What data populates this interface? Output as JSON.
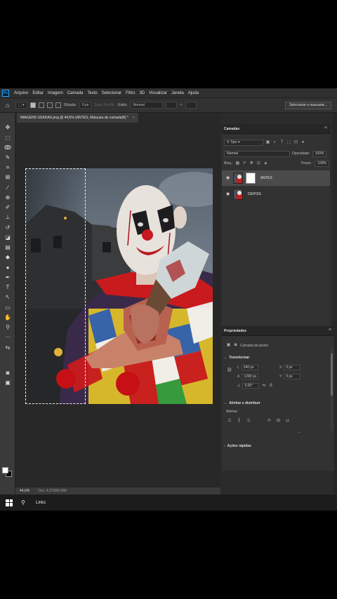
{
  "menu": {
    "logo": "Ps",
    "items": [
      "Arquivo",
      "Editar",
      "Imagem",
      "Camada",
      "Texto",
      "Selecionar",
      "Filtro",
      "3D",
      "Visualizar",
      "Janela",
      "Ajuda"
    ]
  },
  "options_bar": {
    "difusao_label": "Difusão:",
    "difusao_value": "0 px",
    "suav_label": "Suav. Serrilh.",
    "estilo_label": "Estilo:",
    "estilo_value": "Normal",
    "select_mask_button": "Selecionar e mascarar..."
  },
  "document_tab": {
    "title": "IMAGENS USADAS.png @ 44,6% (ANTES, Máscara de camada/8) *",
    "close": "×"
  },
  "status": {
    "zoom": "44,6%",
    "doc": "Doc: 4,27M/8,43M"
  },
  "layers_panel": {
    "title": "Camadas",
    "filter_kind": "Tipo",
    "blend_mode": "Normal",
    "opacity_label": "Opacidade:",
    "opacity_value": "100%",
    "lock_label": "Bloq.:",
    "fill_label": "Preen.:",
    "fill_value": "100%",
    "layers": [
      {
        "name": "ANTES",
        "selected": true,
        "has_mask": true
      },
      {
        "name": "DEPOIS",
        "selected": false,
        "has_mask": false
      }
    ],
    "footer": [
      "GD",
      "fx"
    ]
  },
  "properties_panel": {
    "title": "Propriedades",
    "type_label": "Camada de pixels",
    "transform_title": "Transformar",
    "w_label": "L",
    "w_value": "240 px",
    "h_label": "A",
    "h_value": "1290 px",
    "x_label": "X",
    "x_value": "0 px",
    "y_label": "Y",
    "y_value": "0 px",
    "angle_value": "0,00°",
    "align_title": "Alinhar e distribuir",
    "align_label": "Alinhar:",
    "more": "...",
    "quick_actions_title": "Ações rápidas"
  },
  "taskbar": {
    "links_label": "Links"
  },
  "colors": {
    "accent_ps": "#31a8ff",
    "panel_bg": "#323232",
    "selected_layer": "#4b4b4b",
    "canvas_bg": "#282828"
  }
}
